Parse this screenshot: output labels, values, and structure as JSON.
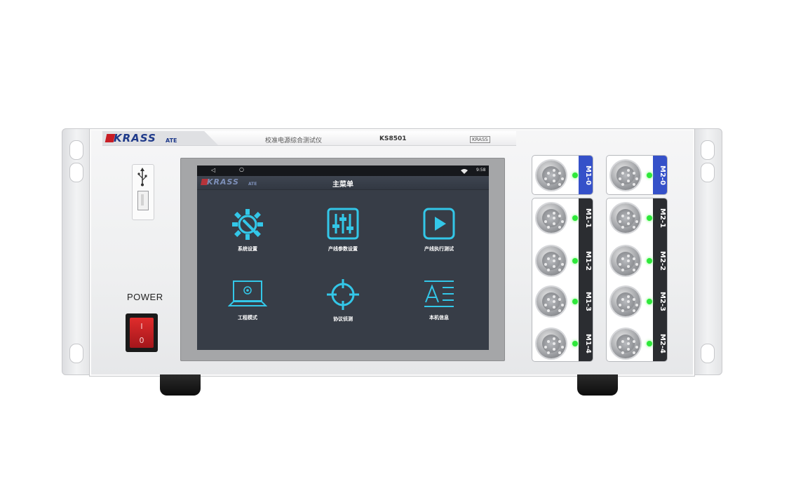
{
  "device": {
    "brand": "KRASS",
    "brand_suffix": "ATE",
    "product_name": "校准电源综合测试仪",
    "model": "KS8501",
    "strip_logo": "KRASS"
  },
  "front_panel": {
    "power_label": "POWER",
    "power_on_mark": "I",
    "power_off_mark": "0",
    "usb_icon": "usb-icon"
  },
  "screen": {
    "status": {
      "back_icon": "◁",
      "home_icon": "○",
      "right_text": "9:58"
    },
    "app_title": "主菜单",
    "app_brand": "KRASS",
    "app_brand_suffix": "ATE",
    "menu": [
      {
        "label": "系统设置",
        "icon": "gear-wrench-icon"
      },
      {
        "label": "产线参数设置",
        "icon": "sliders-icon"
      },
      {
        "label": "产线执行测试",
        "icon": "play-icon"
      },
      {
        "label": "工程模式",
        "icon": "laptop-icon"
      },
      {
        "label": "协议侦测",
        "icon": "crosshair-icon"
      },
      {
        "label": "本机信息",
        "icon": "text-info-icon"
      }
    ]
  },
  "connectors": {
    "m1": [
      {
        "label": "M1-0",
        "led": "on",
        "highlight": true
      },
      {
        "label": "M1-1",
        "led": "on",
        "highlight": false
      },
      {
        "label": "M1-2",
        "led": "on",
        "highlight": false
      },
      {
        "label": "M1-3",
        "led": "on",
        "highlight": false
      },
      {
        "label": "M1-4",
        "led": "on",
        "highlight": false
      }
    ],
    "m2": [
      {
        "label": "M2-0",
        "led": "on",
        "highlight": true
      },
      {
        "label": "M2-1",
        "led": "on",
        "highlight": false
      },
      {
        "label": "M2-2",
        "led": "on",
        "highlight": false
      },
      {
        "label": "M2-3",
        "led": "on",
        "highlight": false
      },
      {
        "label": "M2-4",
        "led": "on",
        "highlight": false
      }
    ]
  },
  "colors": {
    "brand_blue": "#1f3a8a",
    "brand_red": "#c81d25",
    "icon_cyan": "#33c7e8",
    "highlight_blue": "#3551c9",
    "led_green": "#2ee83a"
  }
}
